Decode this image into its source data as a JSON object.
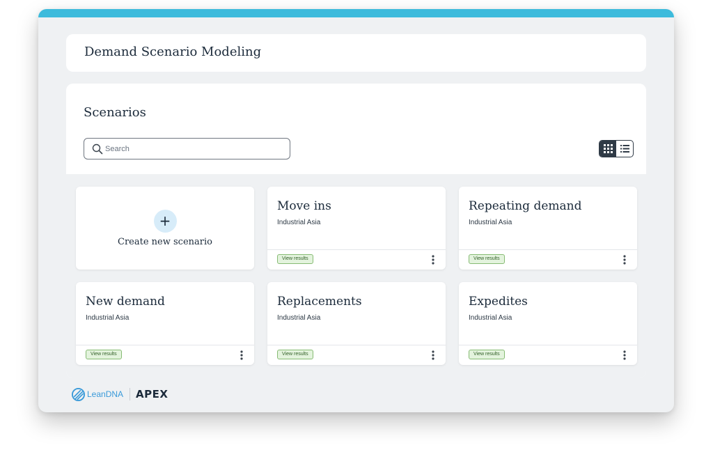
{
  "header": {
    "title": "Demand Scenario Modeling"
  },
  "scenarios": {
    "title": "Scenarios",
    "search": {
      "placeholder": "Search",
      "value": ""
    },
    "view_toggle": {
      "active": "grid",
      "options": [
        "grid",
        "list"
      ]
    },
    "create_label": "Create new scenario",
    "view_results_label": "View results",
    "cards": [
      {
        "title": "Move ins",
        "subtitle": "Industrial Asia"
      },
      {
        "title": "Repeating demand",
        "subtitle": "Industrial Asia"
      },
      {
        "title": "New demand",
        "subtitle": "Industrial Asia"
      },
      {
        "title": "Replacements",
        "subtitle": "Industrial Asia"
      },
      {
        "title": "Expedites",
        "subtitle": "Industrial Asia"
      }
    ]
  },
  "footer": {
    "brand": "LeanDNA",
    "product": "APEX"
  },
  "colors": {
    "accent": "#3dbbdc",
    "badge_bg": "#e3f3dd",
    "badge_border": "#86bb73",
    "brand_blue": "#3a9ad9"
  },
  "icons": {
    "search": "search-icon",
    "grid_view": "grid-view-icon",
    "list_view": "list-view-icon",
    "add": "plus-icon",
    "more": "more-vertical-icon",
    "logo": "leandna-logo-icon"
  }
}
